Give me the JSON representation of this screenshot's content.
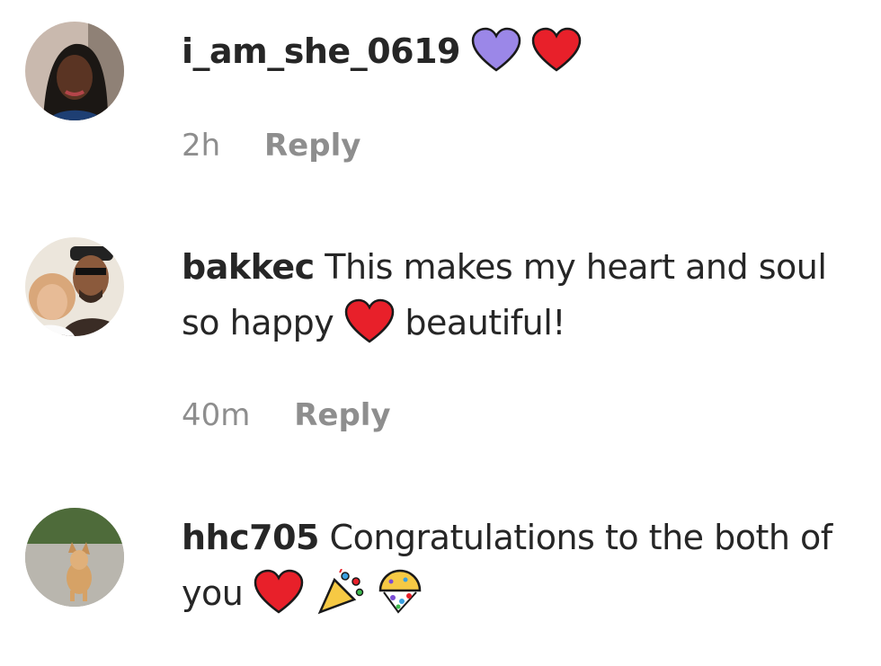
{
  "comments": [
    {
      "username": "i_am_she_0619",
      "text": "",
      "emojis": [
        "purple-heart-icon",
        "red-heart-icon"
      ],
      "time": "2h",
      "reply_label": "Reply"
    },
    {
      "username": "bakkec",
      "text_before": "This makes my heart and soul so happy",
      "emoji_inline": "red-heart-icon",
      "text_after": "beautiful!",
      "time": "40m",
      "reply_label": "Reply"
    },
    {
      "username": "hhc705",
      "text": "Congratulations to the both of you",
      "emojis": [
        "red-heart-icon",
        "party-popper-icon",
        "confetti-ball-icon"
      ]
    }
  ]
}
